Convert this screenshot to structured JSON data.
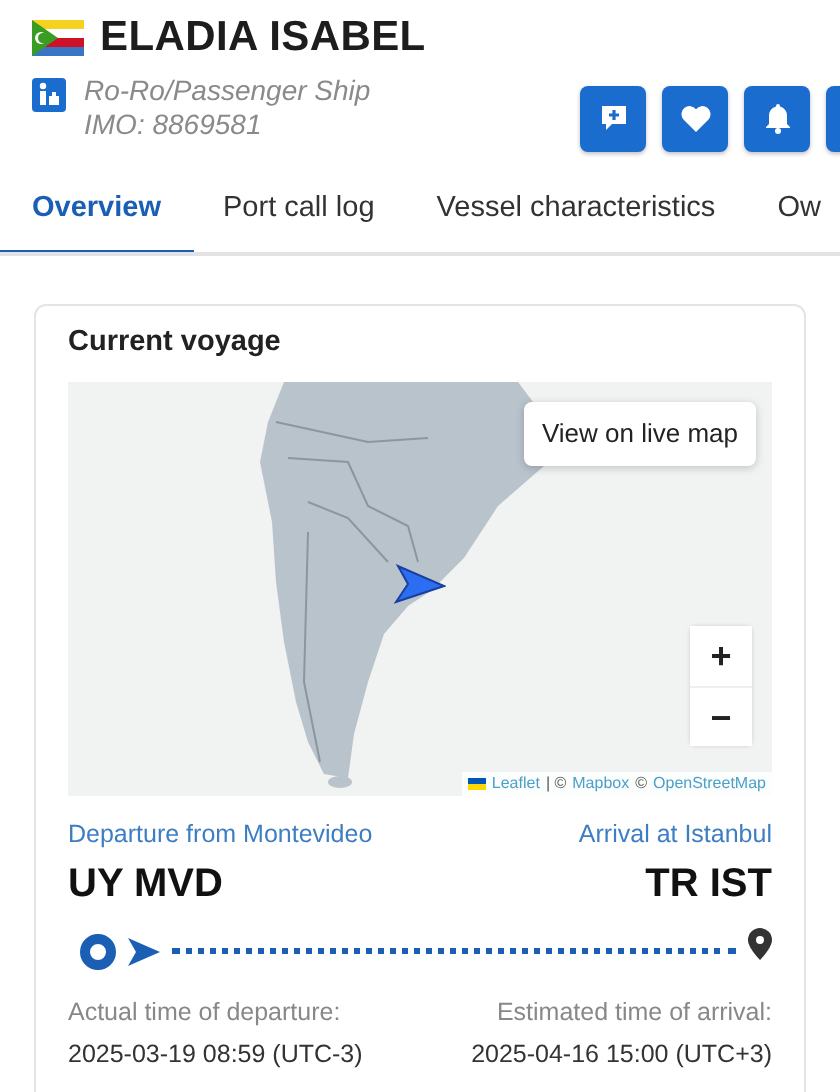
{
  "vessel": {
    "name": "ELADIA ISABEL",
    "type": "Ro-Ro/Passenger Ship",
    "imo": "IMO: 8869581"
  },
  "tabs": [
    {
      "label": "Overview",
      "selected": true
    },
    {
      "label": "Port call log",
      "selected": false
    },
    {
      "label": "Vessel characteristics",
      "selected": false
    },
    {
      "label": "Ow",
      "selected": false
    }
  ],
  "voyage": {
    "title": "Current voyage",
    "map": {
      "button": "View on live map",
      "zoom_in": "+",
      "zoom_out": "−",
      "attribution": [
        {
          "kind": "link",
          "text": "Leaflet"
        },
        {
          "kind": "text",
          "text": "| ©"
        },
        {
          "kind": "link",
          "text": "Mapbox"
        },
        {
          "kind": "text",
          "text": "©"
        },
        {
          "kind": "link",
          "text": "OpenStreetMap"
        }
      ]
    },
    "departure": {
      "label": "Departure from Montevideo",
      "code": "UY MVD",
      "time_label": "Actual time of departure:",
      "time": "2025-03-19 08:59 (UTC-3)"
    },
    "arrival": {
      "label": "Arrival at Istanbul",
      "code": "TR IST",
      "time_label": "Estimated time of arrival:",
      "time": "2025-04-16 15:00 (UTC+3)"
    }
  }
}
